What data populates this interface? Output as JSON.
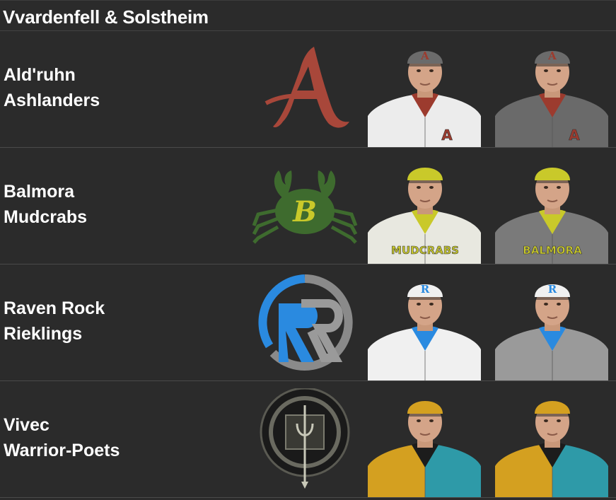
{
  "division": {
    "title": "Vvardenfell & Solstheim"
  },
  "teams": [
    {
      "city": "Ald'ruhn",
      "nickname": "Ashlanders",
      "logo_icon": "gothic-a-logo-icon",
      "logo_letter": "A",
      "colors": {
        "primary": "#a8473a",
        "cap": "#6b6b6b",
        "home_jersey": "#ececec",
        "away_jersey": "#6a6a6a",
        "trim": "#9c3b2e"
      },
      "home_cap_letter": "A",
      "away_cap_letter": "A",
      "home_jersey_text": "A",
      "away_jersey_text": "A"
    },
    {
      "city": "Balmora",
      "nickname": "Mudcrabs",
      "logo_icon": "crab-logo-icon",
      "logo_letter": "B",
      "colors": {
        "primary": "#3e6b2e",
        "cap": "#c9c92a",
        "home_jersey": "#e8e8e0",
        "away_jersey": "#7a7a7a",
        "trim": "#c9c92a"
      },
      "home_cap_letter": "",
      "away_cap_letter": "",
      "home_jersey_text": "MUDCRABS",
      "away_jersey_text": "BALMORA"
    },
    {
      "city": "Raven Rock",
      "nickname": "Rieklings",
      "logo_icon": "rr-logo-icon",
      "logo_letter": "R",
      "colors": {
        "primary": "#2a8ae0",
        "cap": "#f0f0f0",
        "home_jersey": "#f0f0f0",
        "away_jersey": "#9a9a9a",
        "trim": "#2a8ae0"
      },
      "home_cap_letter": "R",
      "away_cap_letter": "R",
      "home_jersey_text": "",
      "away_jersey_text": ""
    },
    {
      "city": "Vivec",
      "nickname": "Warrior-Poets",
      "logo_icon": "seal-logo-icon",
      "logo_letter": "",
      "colors": {
        "primary": "#2e9aa8",
        "cap": "#d4a020",
        "home_jersey": "#d4a020",
        "away_jersey": "#2e9aa8",
        "trim": "#1c1c1c"
      },
      "home_cap_letter": "",
      "away_cap_letter": "",
      "home_jersey_text": "",
      "away_jersey_text": ""
    }
  ]
}
